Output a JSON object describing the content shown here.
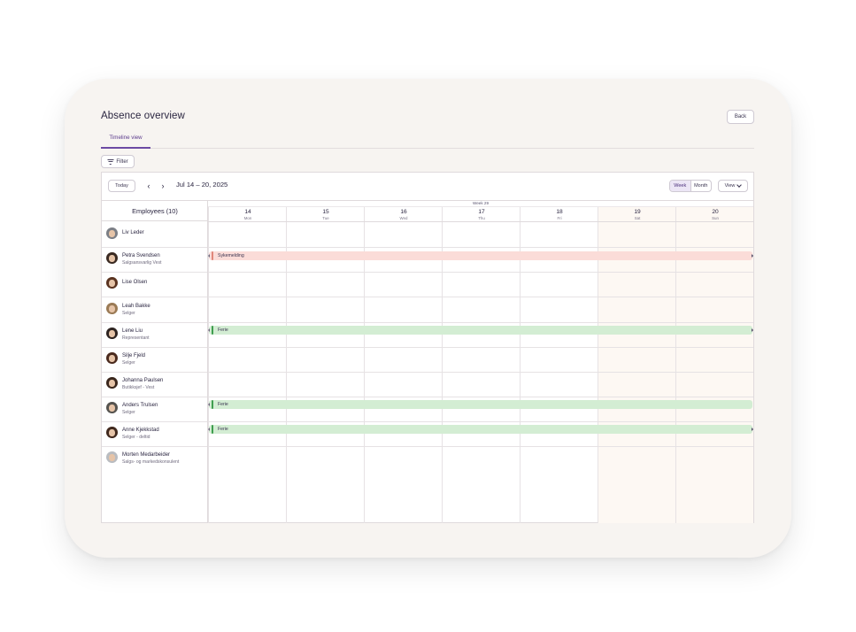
{
  "page": {
    "title": "Absence overview",
    "back_label": "Back",
    "tabs": [
      {
        "label": "Timeline view",
        "active": true
      }
    ],
    "filter_label": "Filter"
  },
  "toolbar": {
    "today_label": "Today",
    "prev_icon": "chevron-left-icon",
    "next_icon": "chevron-right-icon",
    "date_range": "Jul 14 – 20, 2025",
    "period_options": [
      {
        "label": "Week",
        "active": true
      },
      {
        "label": "Month",
        "active": false
      }
    ],
    "view_label": "View"
  },
  "calendar": {
    "employees_header": "Employees (10)",
    "week_label": "Week 29",
    "days": [
      {
        "num": "14",
        "name": "Mon",
        "weekend": false
      },
      {
        "num": "15",
        "name": "Tue",
        "weekend": false
      },
      {
        "num": "16",
        "name": "Wed",
        "weekend": false
      },
      {
        "num": "17",
        "name": "Thu",
        "weekend": false
      },
      {
        "num": "18",
        "name": "Fri",
        "weekend": false
      },
      {
        "num": "19",
        "name": "Sat",
        "weekend": true
      },
      {
        "num": "20",
        "name": "Sun",
        "weekend": true
      }
    ],
    "employees": [
      {
        "name": "Liv Leder",
        "role": ""
      },
      {
        "name": "Petra Svendsen",
        "role": "Salgsansvarlig Vest"
      },
      {
        "name": "Lise Olsen",
        "role": ""
      },
      {
        "name": "Leah Bakke",
        "role": "Selger"
      },
      {
        "name": "Lene Liu",
        "role": "Representant"
      },
      {
        "name": "Silje Fjeld",
        "role": "Selger"
      },
      {
        "name": "Johanna Paulsen",
        "role": "Butikksjef - Vest"
      },
      {
        "name": "Anders Trulsen",
        "role": "Selger"
      },
      {
        "name": "Anne Kjekkstad",
        "role": "Selger - deltid"
      },
      {
        "name": "Morten Medarbeider",
        "role": "Salgs- og markedskonsulent"
      }
    ],
    "absences": [
      {
        "employee": "Petra Svendsen",
        "type": "Sykemelding",
        "color": "#fbdcd8",
        "accent": "#e0877b"
      },
      {
        "employee": "Lene Liu",
        "type": "Ferie",
        "color": "#d3edd3",
        "accent": "#3f9e4f"
      },
      {
        "employee": "Anders Trulsen",
        "type": "Ferie",
        "color": "#d3edd3",
        "accent": "#3f9e4f"
      },
      {
        "employee": "Anne Kjekkstad",
        "type": "Ferie",
        "color": "#d3edd3",
        "accent": "#3f9e4f"
      }
    ]
  },
  "colors": {
    "card_background": "#f7f4f1",
    "accent": "#6c4aa3",
    "weekend": "#fdf8f3"
  }
}
